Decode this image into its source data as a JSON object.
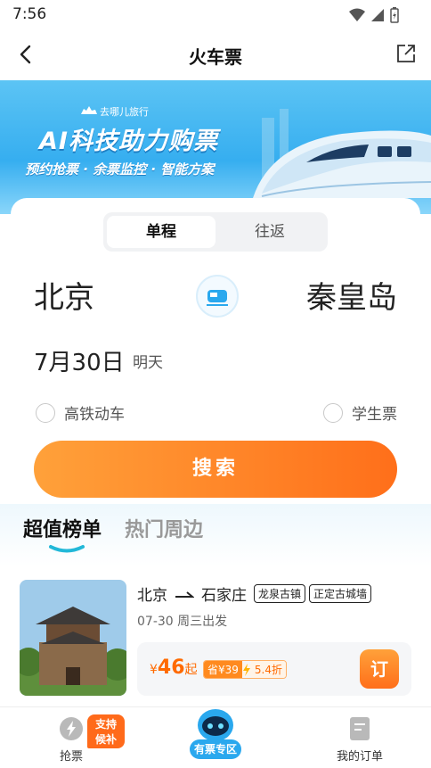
{
  "status_bar": {
    "time": "7:56"
  },
  "nav": {
    "title": "火车票"
  },
  "banner": {
    "brand": "去哪儿旅行",
    "headline": "AI科技助力购票",
    "subline": "预约抢票 · 余票监控 · 智能方案"
  },
  "search": {
    "trip_types": [
      "单程",
      "往返"
    ],
    "selected_trip_type": "单程",
    "from_city": "北京",
    "to_city": "秦皇岛",
    "date": "7月30日",
    "date_relative": "明天",
    "options": [
      {
        "label": "高铁动车",
        "checked": false
      },
      {
        "label": "学生票",
        "checked": false
      }
    ],
    "search_button": "搜索"
  },
  "deals": {
    "tabs": [
      "超值榜单",
      "热门周边"
    ],
    "active_tab": "超值榜单",
    "items": [
      {
        "from": "北京",
        "to": "石家庄",
        "tags": [
          "龙泉古镇",
          "正定古城墙"
        ],
        "date_text": "07-30 周三出发",
        "currency": "¥",
        "price": "46",
        "price_suffix": "起",
        "save_label": "省¥39",
        "discount": "5.4折",
        "book_label": "订"
      }
    ]
  },
  "bottom_nav": {
    "items": [
      {
        "label": "抢票",
        "badge": "支持候补"
      },
      {
        "label": "有票专区"
      },
      {
        "label": "我的订单"
      }
    ]
  },
  "colors": {
    "accent_orange": "#ff6f1a",
    "banner_blue": "#36aef0"
  }
}
